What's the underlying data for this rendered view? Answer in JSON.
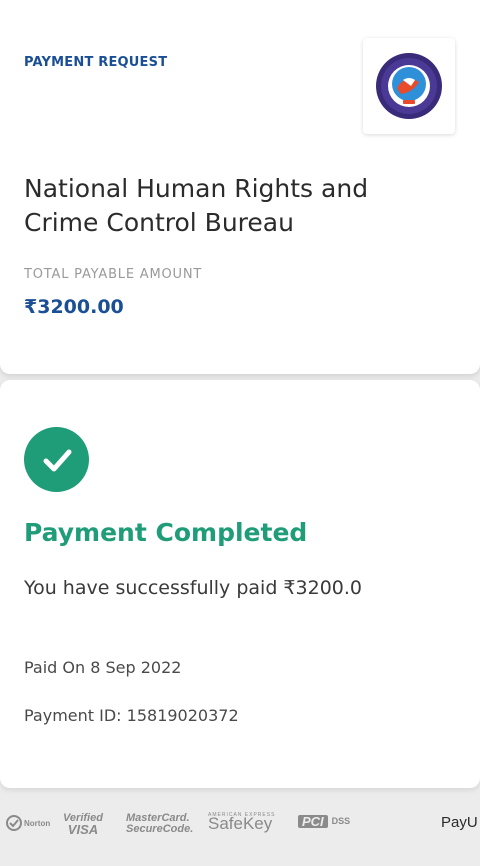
{
  "header": {
    "request_label": "PAYMENT REQUEST",
    "logo_icon": "nhrccb-emblem-icon",
    "merchant_name": "National Human Rights and Crime Control Bureau",
    "amount_label": "TOTAL PAYABLE AMOUNT",
    "amount_value": "₹3200.00"
  },
  "status": {
    "icon": "check-circle-icon",
    "title": "Payment Completed",
    "message": "You have successfully paid ₹3200.0",
    "paid_on": "Paid On 8 Sep 2022",
    "payment_id": "Payment ID: 15819020372"
  },
  "footer": {
    "badges": {
      "norton": "Norton",
      "visa_line1": "Verified",
      "visa_line2": "VISA",
      "mc_line1": "MasterCard.",
      "mc_line2": "SecureCode.",
      "safekey_top": "AMERICAN EXPRESS",
      "safekey": "SafeKey",
      "pci": "PCI",
      "dss": "DSS",
      "payu": "PayU"
    }
  },
  "colors": {
    "accent_blue": "#1a4f95",
    "success_green": "#1f9c78",
    "background": "#ececec"
  }
}
